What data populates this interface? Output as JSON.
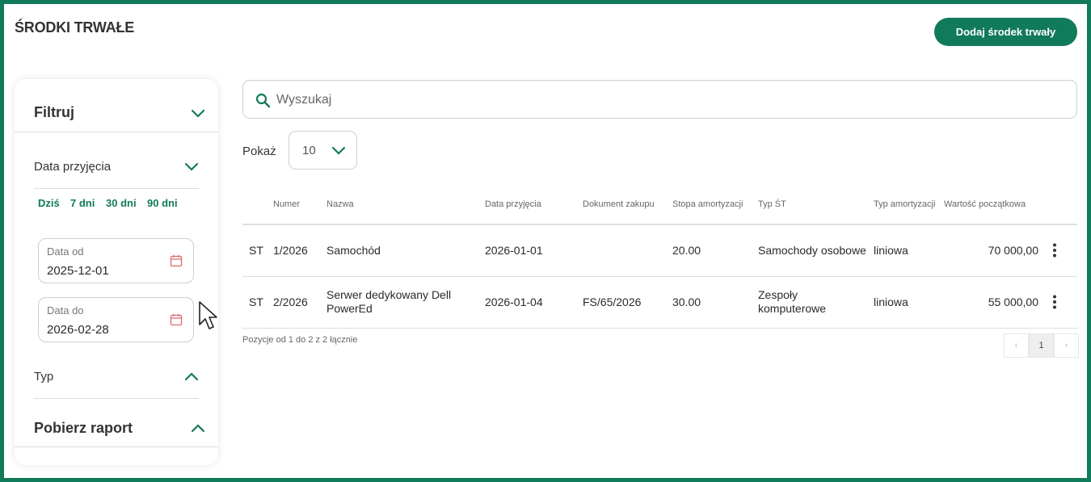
{
  "header": {
    "title": "ŚRODKI TRWAŁE",
    "add_button": "Dodaj środek trwały"
  },
  "colors": {
    "accent": "#117a5a",
    "calendar_icon": "#e0686a"
  },
  "sidebar": {
    "filter_title": "Filtruj",
    "date_section": "Data przyjęcia",
    "quick_ranges": [
      "Dziś",
      "7 dni",
      "30 dni",
      "90 dni"
    ],
    "date_from": {
      "label": "Data od",
      "value": "2025-12-01"
    },
    "date_to": {
      "label": "Data do",
      "value": "2026-02-28"
    },
    "type_section": "Typ",
    "report_title": "Pobierz raport"
  },
  "search": {
    "placeholder": "Wyszukaj"
  },
  "page_size": {
    "label": "Pokaż",
    "value": "10"
  },
  "table": {
    "columns": [
      "",
      "Numer",
      "Nazwa",
      "Data przyjęcia",
      "Dokument zakupu",
      "Stopa amortyzacji",
      "Typ ŚT",
      "Typ amortyzacji",
      "Wartość początkowa",
      ""
    ],
    "rows": [
      [
        "ST",
        "1/2026",
        "Samochód",
        "2026-01-01",
        "",
        "20.00",
        "Samochody osobowe",
        "liniowa",
        "70 000,00"
      ],
      [
        "ST",
        "2/2026",
        "Serwer dedykowany Dell PowerEd",
        "2026-01-04",
        "FS/65/2026",
        "30.00",
        "Zespoły komputerowe",
        "liniowa",
        "55 000,00"
      ]
    ]
  },
  "pagination": {
    "summary": "Pozycje od 1 do 2 z 2 łącznie",
    "prev": "‹",
    "current": "1",
    "next": "›"
  }
}
